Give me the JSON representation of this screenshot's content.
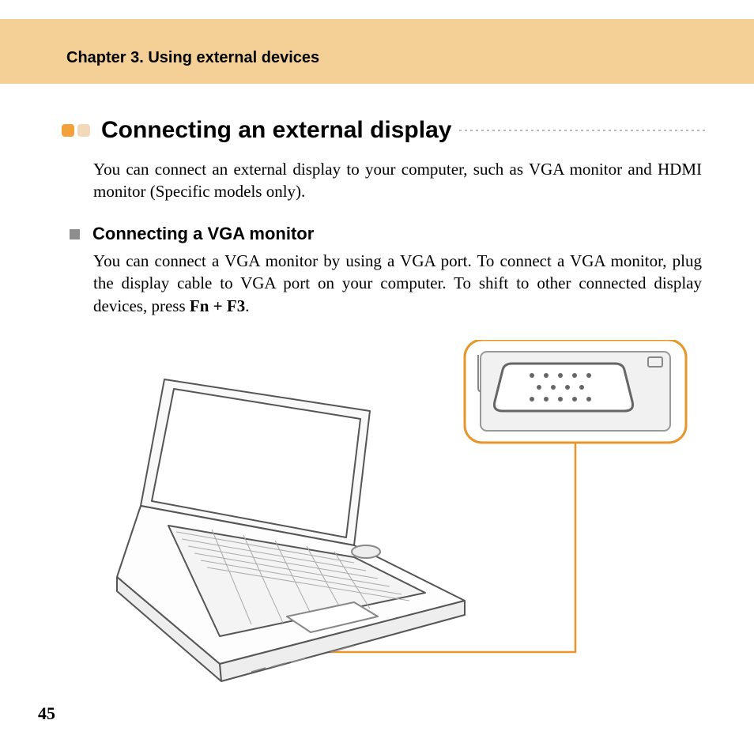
{
  "chapter": "Chapter 3. Using external devices",
  "section_title": "Connecting an external display",
  "intro_text": "You can connect an external display to your computer, such as VGA monitor and HDMI monitor (Specific models only).",
  "sub_heading": "Connecting a VGA monitor",
  "body_prefix": "You can connect a VGA monitor by using a VGA port. To connect a VGA monitor, plug the display cable to VGA port on your computer. To shift to other connected display devices, press ",
  "body_key": "Fn + F3",
  "body_suffix": ".",
  "page_number": "45",
  "accent_orange": "#e8952a",
  "accent_light": "#f4cf96"
}
